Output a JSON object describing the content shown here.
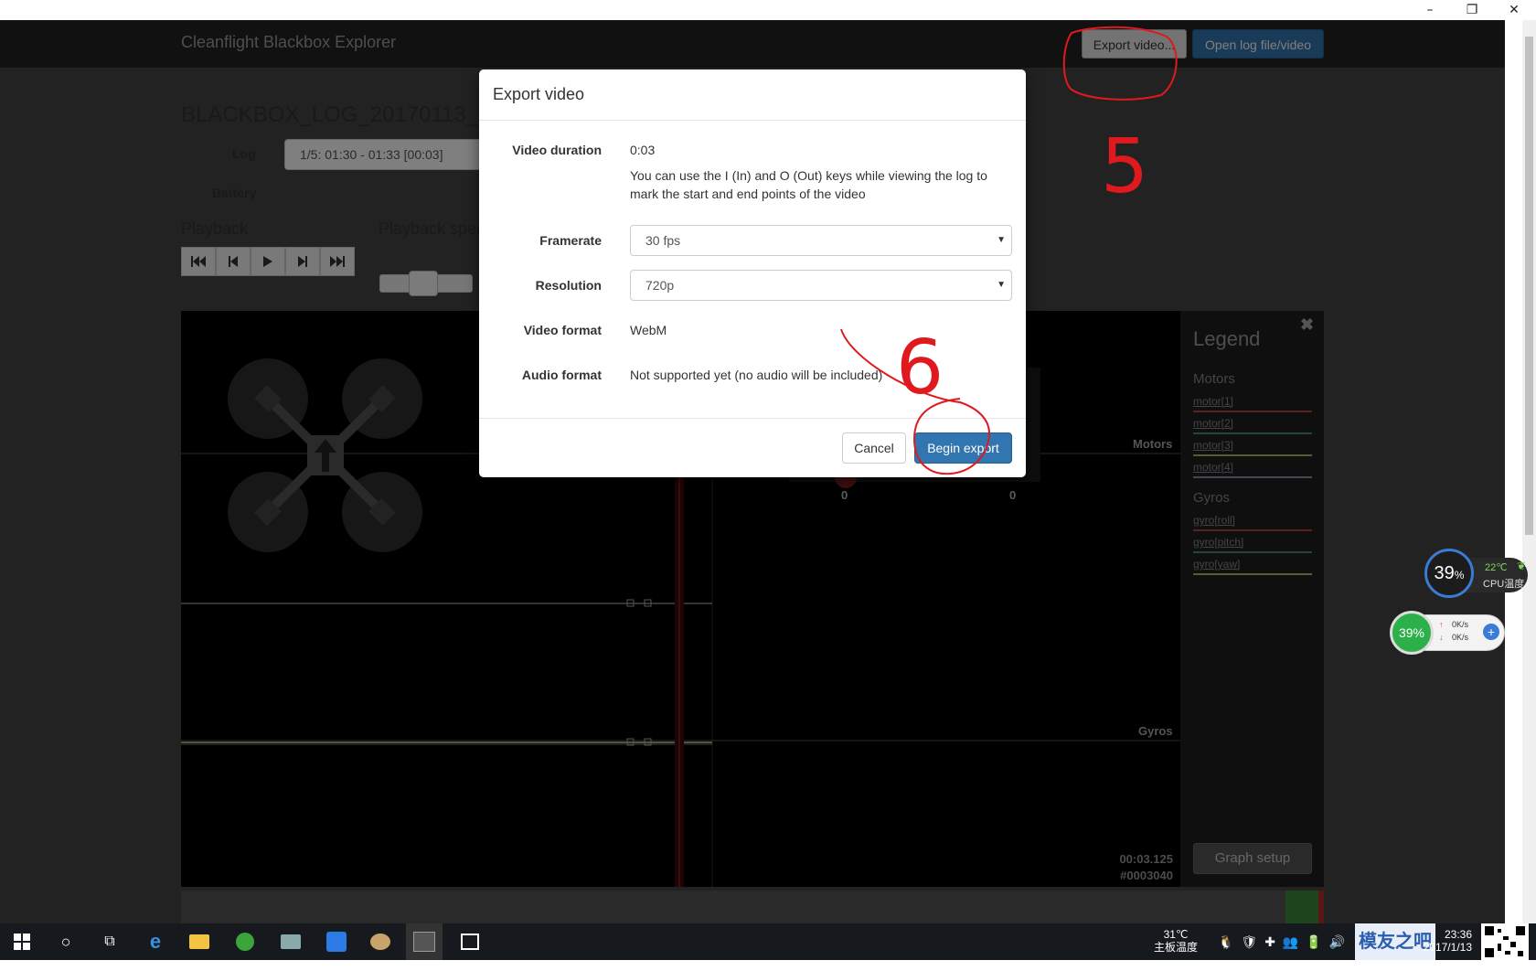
{
  "window": {
    "minimize_glyph": "–",
    "restore_glyph": "❐",
    "close_glyph": "✕"
  },
  "navbar": {
    "brand": "Cleanflight Blackbox Explorer",
    "export_label": "Export video...",
    "open_label": "Open log file/video"
  },
  "log": {
    "title": "BLACKBOX_LOG_20170113_",
    "log_label": "Log",
    "log_value": "1/5: 01:30 - 01:33 [00:03]",
    "battery_label": "Battery"
  },
  "playback": {
    "heading": "Playback",
    "speed_heading": "Playback spee",
    "buttons": [
      "skip-back",
      "step-back",
      "play",
      "step-forward",
      "skip-forward"
    ]
  },
  "graph": {
    "motors_label": "Motors",
    "gyros_label": "Gyros",
    "motor_values": [
      "0",
      "0"
    ],
    "time": "00:03.125",
    "frame": "#0003040"
  },
  "legend": {
    "title": "Legend",
    "close_glyph": "✖",
    "groups": [
      {
        "name": "Motors",
        "items": [
          {
            "label": "motor[1]",
            "color": "#b5473a"
          },
          {
            "label": "motor[2]",
            "color": "#4a8a72"
          },
          {
            "label": "motor[3]",
            "color": "#b5b56a"
          },
          {
            "label": "motor[4]",
            "color": "#8a8fa8"
          }
        ]
      },
      {
        "name": "Gyros",
        "items": [
          {
            "label": "gyro[roll]",
            "color": "#b5473a"
          },
          {
            "label": "gyro[pitch]",
            "color": "#4a8a72"
          },
          {
            "label": "gyro[yaw]",
            "color": "#b5b56a"
          }
        ]
      }
    ],
    "setup_label": "Graph setup"
  },
  "modal": {
    "title": "Export video",
    "duration_label": "Video duration",
    "duration_value": "0:03",
    "hint": "You can use the I (In) and O (Out) keys while viewing the log to mark the start and end points of the video",
    "framerate_label": "Framerate",
    "framerate_value": "30 fps",
    "resolution_label": "Resolution",
    "resolution_value": "720p",
    "format_label": "Video format",
    "format_value": "WebM",
    "audio_label": "Audio format",
    "audio_value": "Not supported yet (no audio will be included)",
    "cancel_label": "Cancel",
    "begin_label": "Begin export"
  },
  "annotations": {
    "step5": "5",
    "step6": "6"
  },
  "widgets": {
    "cpu_percent": "39",
    "cpu_unit": "%",
    "cpu_temp": "22℃",
    "cpu_temp_label": "CPU温度",
    "mem_percent": "39%",
    "up_speed": "0K/s",
    "down_speed": "0K/s"
  },
  "taskbar": {
    "weather_temp": "31℃",
    "weather_label": "主板温度",
    "time": "23:36",
    "date": "2017/1/13",
    "watermark": "模友之吧"
  },
  "colors": {
    "primary": "#3276b1",
    "annotation": "#e0191f",
    "navbar": "#222222"
  }
}
